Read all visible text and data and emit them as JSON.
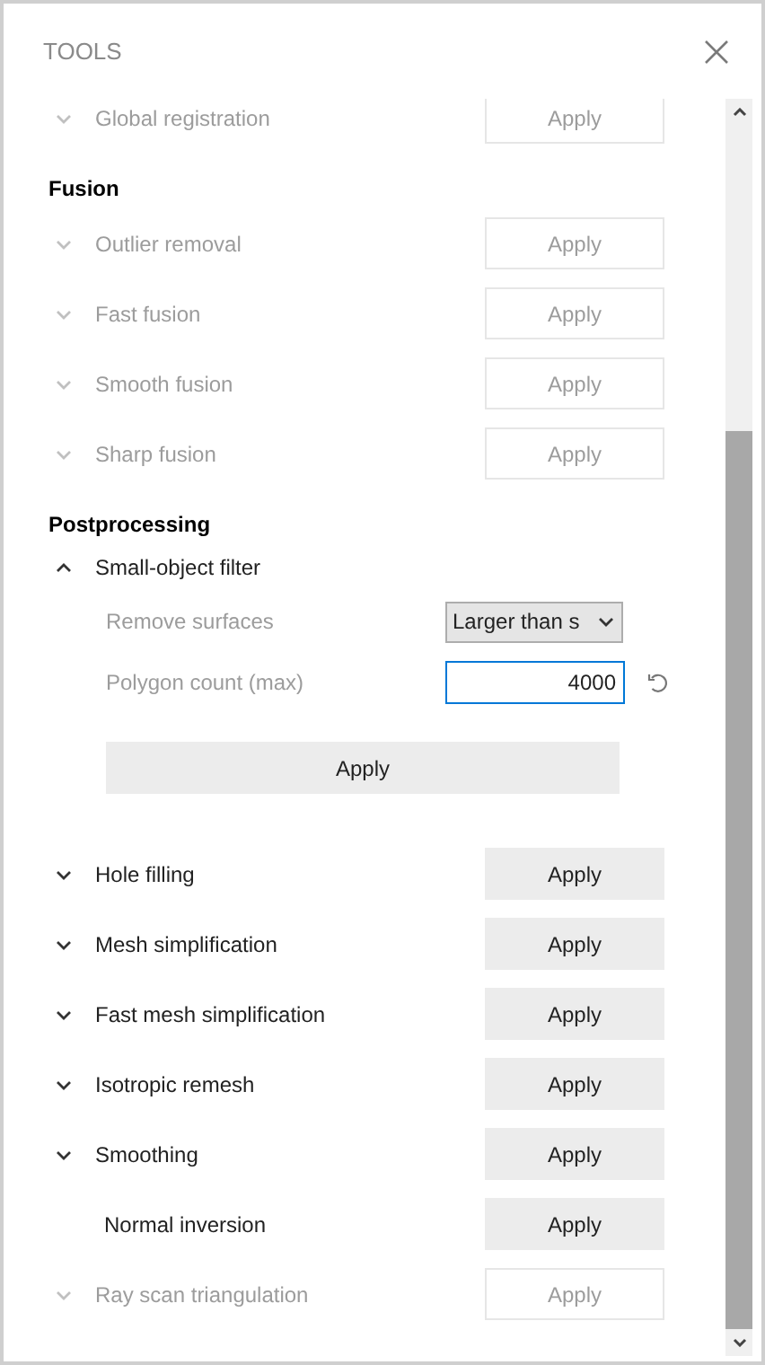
{
  "window": {
    "title": "TOOLS"
  },
  "items": [
    {
      "kind": "tool",
      "label": "Global registration",
      "expanded": false,
      "disabled": true,
      "button": "Apply"
    },
    {
      "kind": "heading",
      "label": "Fusion"
    },
    {
      "kind": "tool",
      "label": "Outlier removal",
      "expanded": false,
      "disabled": true,
      "button": "Apply"
    },
    {
      "kind": "tool",
      "label": "Fast fusion",
      "expanded": false,
      "disabled": true,
      "button": "Apply"
    },
    {
      "kind": "tool",
      "label": "Smooth fusion",
      "expanded": false,
      "disabled": true,
      "button": "Apply"
    },
    {
      "kind": "tool",
      "label": "Sharp fusion",
      "expanded": false,
      "disabled": true,
      "button": "Apply"
    },
    {
      "kind": "heading",
      "label": "Postprocessing"
    },
    {
      "kind": "tool",
      "label": "Small-object filter",
      "expanded": true,
      "disabled": false,
      "button": "Apply",
      "settings": [
        {
          "kind": "select",
          "label": "Remove surfaces",
          "value": "Larger than s"
        },
        {
          "kind": "number",
          "label": "Polygon count (max)",
          "value": "4000",
          "focused": true
        }
      ]
    },
    {
      "kind": "tool",
      "label": "Hole filling",
      "expanded": false,
      "disabled": false,
      "button": "Apply"
    },
    {
      "kind": "tool",
      "label": "Mesh simplification",
      "expanded": false,
      "disabled": false,
      "button": "Apply"
    },
    {
      "kind": "tool",
      "label": "Fast mesh simplification",
      "expanded": false,
      "disabled": false,
      "button": "Apply"
    },
    {
      "kind": "tool",
      "label": "Isotropic remesh",
      "expanded": false,
      "disabled": false,
      "button": "Apply"
    },
    {
      "kind": "tool",
      "label": "Smoothing",
      "expanded": false,
      "disabled": false,
      "button": "Apply"
    },
    {
      "kind": "tool",
      "label": "Normal inversion",
      "disabled": false,
      "button": "Apply"
    },
    {
      "kind": "tool",
      "label": "Ray scan triangulation",
      "expanded": false,
      "disabled": true,
      "button": "Apply"
    }
  ]
}
